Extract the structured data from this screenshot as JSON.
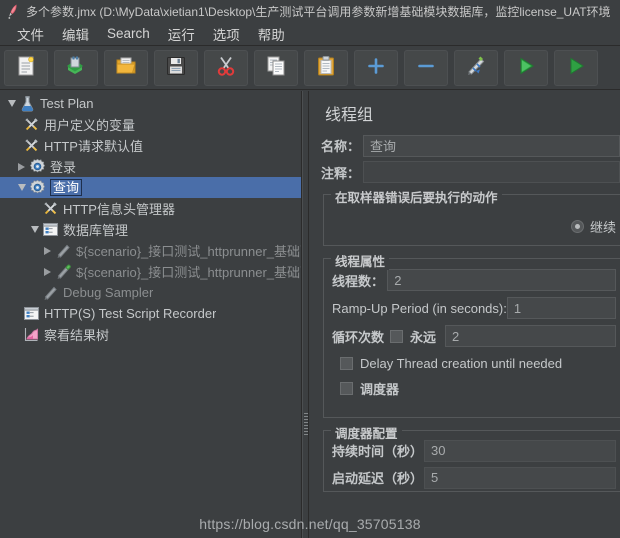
{
  "window": {
    "title": "多个参数.jmx (D:\\MyData\\xietian1\\Desktop\\生产测试平台调用参数新增基础模块数据库，监控license_UAT环境",
    "icon": "jmeter-feather-icon"
  },
  "menubar": {
    "items": [
      {
        "label": "文件",
        "name": "menu-file"
      },
      {
        "label": "编辑",
        "name": "menu-edit"
      },
      {
        "label": "Search",
        "name": "menu-search",
        "mnemonic": "S"
      },
      {
        "label": "运行",
        "name": "menu-run"
      },
      {
        "label": "选项",
        "name": "menu-options"
      },
      {
        "label": "帮助",
        "name": "menu-help"
      }
    ]
  },
  "toolbar": {
    "buttons": [
      {
        "icon": "new-document-icon",
        "name": "toolbar-new"
      },
      {
        "icon": "templates-icon",
        "name": "toolbar-templates"
      },
      {
        "icon": "open-folder-icon",
        "name": "toolbar-open"
      },
      {
        "icon": "save-floppy-icon",
        "name": "toolbar-save"
      },
      {
        "icon": "cut-scissors-icon",
        "name": "toolbar-cut"
      },
      {
        "icon": "copy-pages-icon",
        "name": "toolbar-copy"
      },
      {
        "icon": "paste-clipboard-icon",
        "name": "toolbar-paste"
      },
      {
        "icon": "plus-icon",
        "name": "toolbar-expand-all"
      },
      {
        "icon": "minus-icon",
        "name": "toolbar-collapse-all"
      },
      {
        "icon": "toggle-pencil-icon",
        "name": "toolbar-toggle"
      },
      {
        "icon": "play-green-icon",
        "name": "toolbar-start"
      },
      {
        "icon": "play-remote-icon",
        "name": "toolbar-start-no-pauses"
      }
    ]
  },
  "tree": {
    "nodes": [
      {
        "label": "Test Plan",
        "icon": "test-plan-flask-icon",
        "indent": 0,
        "twisty": "open",
        "state": "normal",
        "name": "tree-node-test-plan"
      },
      {
        "label": "用户定义的变量",
        "icon": "config-tools-icon",
        "indent": 1,
        "twisty": "none",
        "state": "normal",
        "name": "tree-node-user-defined-variables"
      },
      {
        "label": "HTTP请求默认值",
        "icon": "config-tools-icon",
        "indent": 1,
        "twisty": "none",
        "state": "normal",
        "name": "tree-node-http-request-defaults"
      },
      {
        "label": "登录",
        "icon": "thread-group-gear-icon",
        "indent": 1,
        "twisty": "closed",
        "state": "normal",
        "name": "tree-node-thread-group-login"
      },
      {
        "label": "查询",
        "icon": "thread-group-gear-icon",
        "indent": 1,
        "twisty": "open",
        "state": "selected",
        "name": "tree-node-thread-group-query"
      },
      {
        "label": "HTTP信息头管理器",
        "icon": "config-tools-icon",
        "indent": 2,
        "twisty": "none",
        "state": "normal",
        "name": "tree-node-http-header-manager"
      },
      {
        "label": "数据库管理",
        "icon": "module-window-icon",
        "indent": 2,
        "twisty": "open",
        "state": "normal",
        "name": "tree-node-database-management"
      },
      {
        "label": "${scenario}_接口测试_httprunner_基础配置.",
        "icon": "sampler-pencil-grey-icon",
        "indent": 3,
        "twisty": "closed",
        "state": "dim",
        "name": "tree-node-sampler-1"
      },
      {
        "label": "${scenario}_接口测试_httprunner_基础配置",
        "icon": "sampler-pencil-green-icon",
        "indent": 3,
        "twisty": "closed",
        "state": "dim",
        "name": "tree-node-sampler-2"
      },
      {
        "label": "Debug Sampler",
        "icon": "sampler-pencil-grey-icon",
        "indent": 2,
        "twisty": "none",
        "state": "dim",
        "name": "tree-node-debug-sampler"
      },
      {
        "label": "HTTP(S) Test Script Recorder",
        "icon": "recorder-window-icon",
        "indent": 1,
        "twisty": "none",
        "state": "normal",
        "name": "tree-node-http-test-script-recorder"
      },
      {
        "label": "察看结果树",
        "icon": "view-results-tree-icon",
        "indent": 1,
        "twisty": "none",
        "state": "normal",
        "name": "tree-node-view-results-tree"
      }
    ]
  },
  "panel": {
    "title": "线程组",
    "name_label": "名称：",
    "name_value": "查询",
    "comment_label": "注释：",
    "comment_value": "",
    "on_error_group": "在取样器错误后要执行的动作",
    "on_error_selected": "继续",
    "thread_properties": {
      "legend": "线程属性",
      "threads_label": "线程数：",
      "threads_value": "2",
      "rampup_label": "Ramp-Up Period (in seconds):",
      "rampup_value": "1",
      "loops_label": "循环次数",
      "forever_label": "永远",
      "loops_value": "2",
      "delay_thread_label": "Delay Thread creation until needed",
      "scheduler_label": "调度器"
    },
    "scheduler_config": {
      "legend": "调度器配置",
      "duration_label": "持续时间（秒）",
      "duration_value": "30",
      "startup_delay_label": "启动延迟（秒）",
      "startup_delay_value": "5"
    }
  },
  "watermark": "https://blog.csdn.net/qq_35705138",
  "colors": {
    "window_bg": "#3c3f41",
    "selection_blue": "#4a6ea9",
    "text": "#c5c8ca",
    "border": "#55585a"
  }
}
